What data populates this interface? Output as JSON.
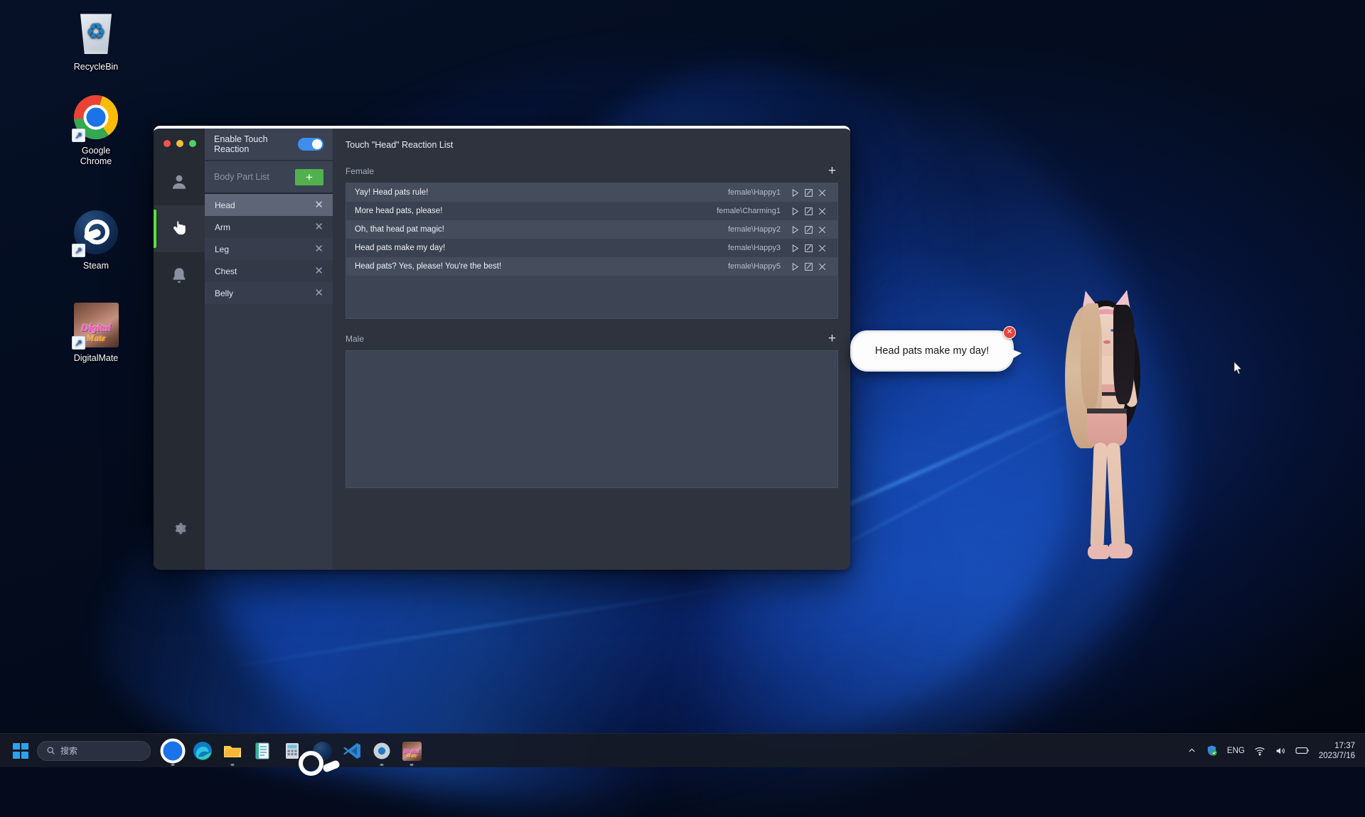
{
  "desktop": {
    "icons": [
      {
        "label": "RecycleBin",
        "icon": "recycle-bin-icon",
        "shortcut": false
      },
      {
        "label": "Google\nChrome",
        "label_line1": "Google",
        "label_line2": "Chrome",
        "icon": "chrome-icon",
        "shortcut": true
      },
      {
        "label": "Steam",
        "icon": "steam-icon",
        "shortcut": true
      },
      {
        "label": "DigitalMate",
        "icon": "digitalmate-icon",
        "shortcut": true,
        "thumb_line1": "Digital",
        "thumb_line2": "Mate"
      }
    ]
  },
  "window": {
    "traffic_lights": [
      {
        "name": "close",
        "color": "#f2544b"
      },
      {
        "name": "minimize",
        "color": "#f3be3b"
      },
      {
        "name": "maximize",
        "color": "#4fd35c"
      }
    ],
    "rail": {
      "items": [
        {
          "name": "character-tab",
          "icon": "person-icon",
          "active": false
        },
        {
          "name": "touch-tab",
          "icon": "touch-hand-icon",
          "active": true
        },
        {
          "name": "notification-tab",
          "icon": "bell-icon",
          "active": false
        }
      ],
      "bottom": {
        "name": "settings-tab",
        "icon": "gear-icon"
      },
      "active_accent": "#57e03a"
    },
    "settings": {
      "enable_touch_label": "Enable Touch Reaction",
      "enable_touch_on": true,
      "toggle_color": "#3e8ef0",
      "body_part_list_label": "Body Part List",
      "add_button_label": "+",
      "add_button_color": "#52b14e",
      "body_parts": [
        {
          "label": "Head",
          "selected": true
        },
        {
          "label": "Arm",
          "selected": false
        },
        {
          "label": "Leg",
          "selected": false
        },
        {
          "label": "Chest",
          "selected": false
        },
        {
          "label": "Belly",
          "selected": false
        }
      ]
    },
    "main": {
      "title": "Touch \"Head\" Reaction List",
      "sections": [
        {
          "label": "Female",
          "add_label": "+",
          "rows": [
            {
              "text": "Yay! Head pats rule!",
              "path": "female\\Happy1"
            },
            {
              "text": "More head pats, please!",
              "path": "female\\Charming1"
            },
            {
              "text": "Oh, that head pat magic!",
              "path": "female\\Happy2"
            },
            {
              "text": "Head pats make my day!",
              "path": "female\\Happy3"
            },
            {
              "text": "Head pats? Yes, please! You're the best!",
              "path": "female\\Happy5"
            }
          ]
        },
        {
          "label": "Male",
          "add_label": "+",
          "rows": []
        }
      ],
      "row_actions": [
        {
          "name": "play-icon"
        },
        {
          "name": "edit-icon"
        },
        {
          "name": "delete-icon"
        }
      ]
    }
  },
  "speech_bubble": {
    "text": "Head pats make my day!",
    "close_label": "✕",
    "close_color": "#e8443c"
  },
  "taskbar": {
    "start_label": "start-button",
    "search_placeholder": "搜索",
    "apps": [
      {
        "name": "chrome",
        "running": true
      },
      {
        "name": "edge",
        "running": false
      },
      {
        "name": "file-explorer",
        "running": true
      },
      {
        "name": "notepad",
        "running": false
      },
      {
        "name": "calculator",
        "running": false
      },
      {
        "name": "steam",
        "running": false
      },
      {
        "name": "vscode",
        "running": false
      },
      {
        "name": "unity",
        "running": true
      },
      {
        "name": "digitalmate",
        "running": true
      }
    ],
    "tray": {
      "chevron": "show-hidden-icons",
      "defender": "windows-security-icon",
      "language": "ENG",
      "wifi": "wifi-icon",
      "volume": "volume-icon",
      "battery": "battery-icon"
    },
    "clock": {
      "time": "17:37",
      "date": "2023/7/16"
    }
  }
}
